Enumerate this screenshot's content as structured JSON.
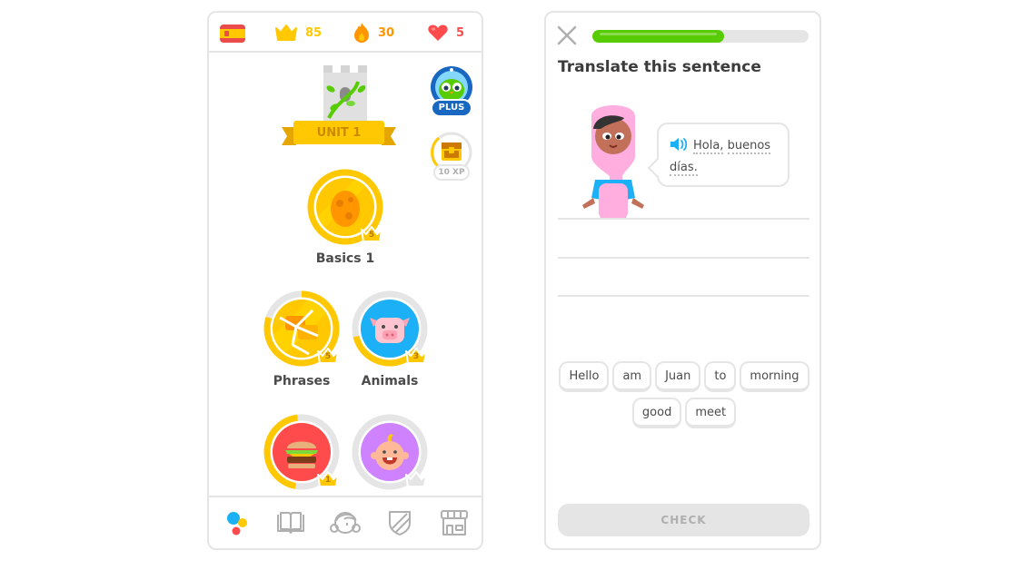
{
  "left_screen": {
    "topbar": {
      "language_flag": "spain-flag",
      "crowns": {
        "icon": "crown-icon",
        "value": "85",
        "color": "#ffc800"
      },
      "streak": {
        "icon": "fire-icon",
        "value": "30",
        "color": "#ff9600"
      },
      "hearts": {
        "icon": "heart-icon",
        "value": "5",
        "color": "#ff4b4b"
      }
    },
    "unit": {
      "label": "UNIT 1",
      "icon": "castle-icon"
    },
    "plus_badge": {
      "label": "PLUS",
      "icon": "owl-icon"
    },
    "chest": {
      "label": "10 XP",
      "icon": "treasure-chest-icon",
      "progress": 0.3
    },
    "skills": [
      {
        "name": "Basics 1",
        "icon": "egg-icon",
        "crown_level": "5",
        "progress": 1.0,
        "color": "#ffc800",
        "cracked": false
      },
      {
        "name": "Phrases",
        "icon": "chat-bubbles-icon",
        "crown_level": "5",
        "progress": 0.8,
        "color": "#ffc800",
        "cracked": true
      },
      {
        "name": "Animals",
        "icon": "pig-icon",
        "crown_level": "3",
        "progress": 0.35,
        "color": "#1cb0f6",
        "cracked": false
      },
      {
        "name": "",
        "icon": "burger-icon",
        "crown_level": "1",
        "progress": 0.45,
        "color": "#ff4b4b",
        "cracked": false
      },
      {
        "name": "",
        "icon": "baby-icon",
        "crown_level": "",
        "progress": 0.0,
        "color": "#ce82ff",
        "cracked": false
      }
    ],
    "bottom_nav": [
      {
        "name": "learn",
        "icon": "learn-dots-icon",
        "active": true
      },
      {
        "name": "stories",
        "icon": "book-icon",
        "active": false
      },
      {
        "name": "profile",
        "icon": "avatar-icon",
        "active": false
      },
      {
        "name": "leagues",
        "icon": "shield-icon",
        "active": false
      },
      {
        "name": "shop",
        "icon": "shop-icon",
        "active": false
      }
    ]
  },
  "right_screen": {
    "lesson_progress": 0.61,
    "title": "Translate this sentence",
    "prompt": {
      "words": [
        "Hola,",
        "buenos",
        "días."
      ]
    },
    "word_bank": {
      "row1": [
        "Hello",
        "am",
        "Juan",
        "to",
        "morning"
      ],
      "row2": [
        "good",
        "meet"
      ]
    },
    "check_label": "CHECK"
  }
}
